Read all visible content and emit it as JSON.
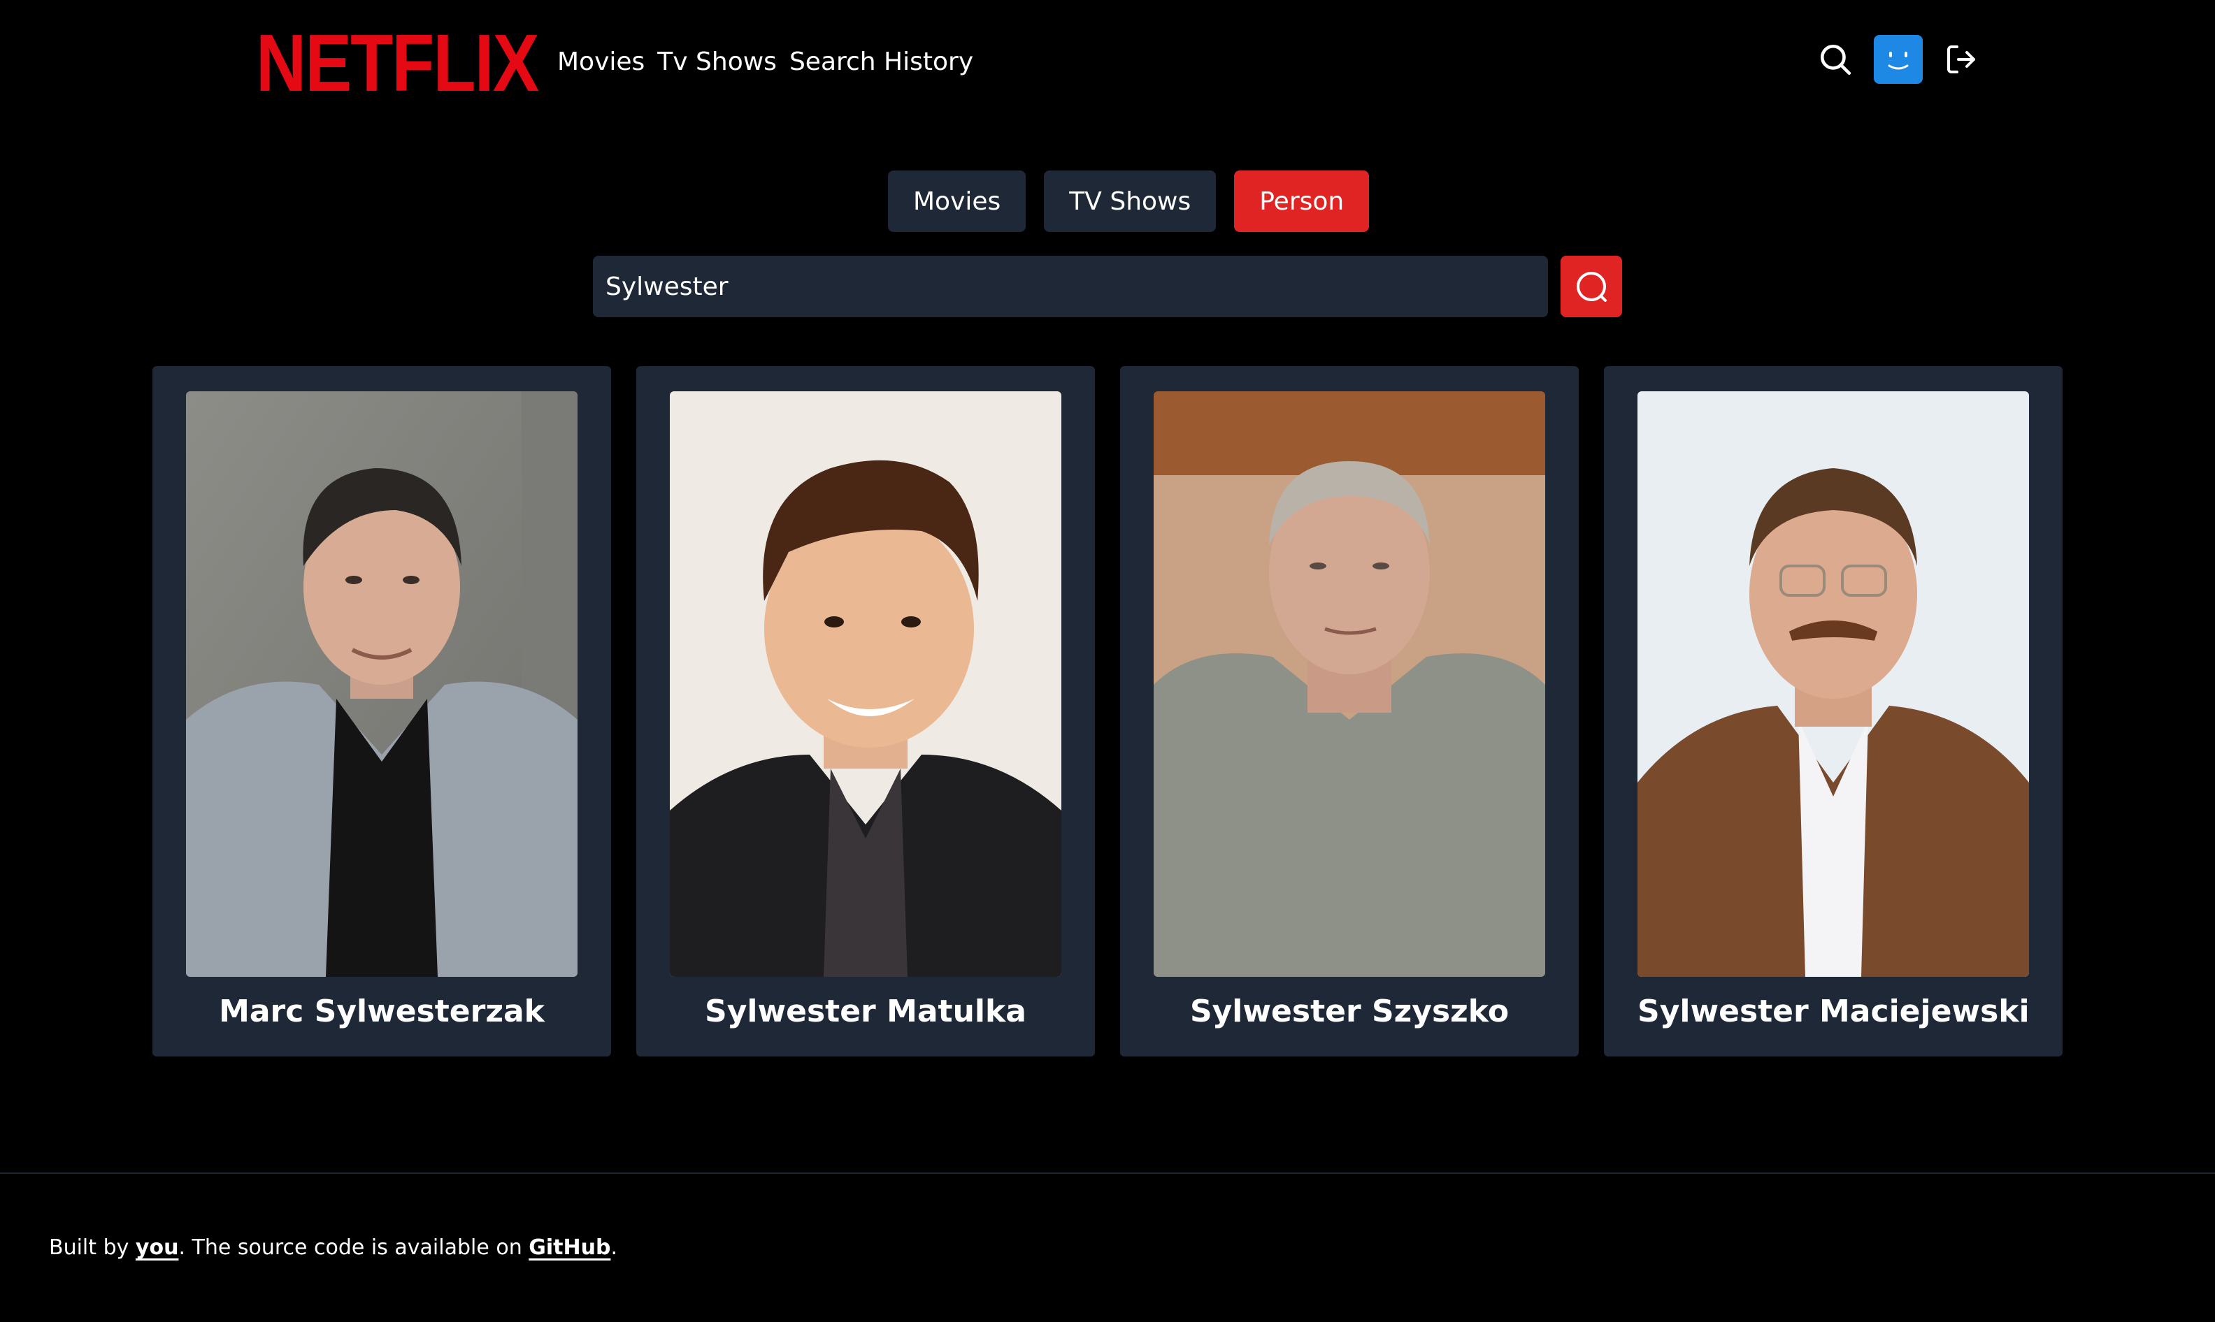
{
  "header": {
    "logo": "NETFLIX",
    "nav": [
      "Movies",
      "Tv Shows",
      "Search History"
    ],
    "icons": {
      "search": "search-icon",
      "profile": "profile-avatar-icon",
      "logout": "logout-icon"
    }
  },
  "search": {
    "tabs": [
      {
        "label": "Movies",
        "active": false
      },
      {
        "label": "TV Shows",
        "active": false
      },
      {
        "label": "Person",
        "active": true
      }
    ],
    "query": "Sylwester",
    "button_icon": "search-icon"
  },
  "results": [
    {
      "name": "Marc Sylwesterzak"
    },
    {
      "name": "Sylwester Matulka"
    },
    {
      "name": "Sylwester Szyszko"
    },
    {
      "name": "Sylwester Maciejewski"
    }
  ],
  "footer": {
    "prefix": "Built by ",
    "author_link": "you",
    "middle": ". The source code is available on ",
    "repo_link": "GitHub",
    "suffix": "."
  },
  "colors": {
    "brand": "#e50914",
    "active_tab": "#e02424",
    "surface": "#1f2837",
    "avatar": "#1e88e5",
    "background": "#000000"
  }
}
